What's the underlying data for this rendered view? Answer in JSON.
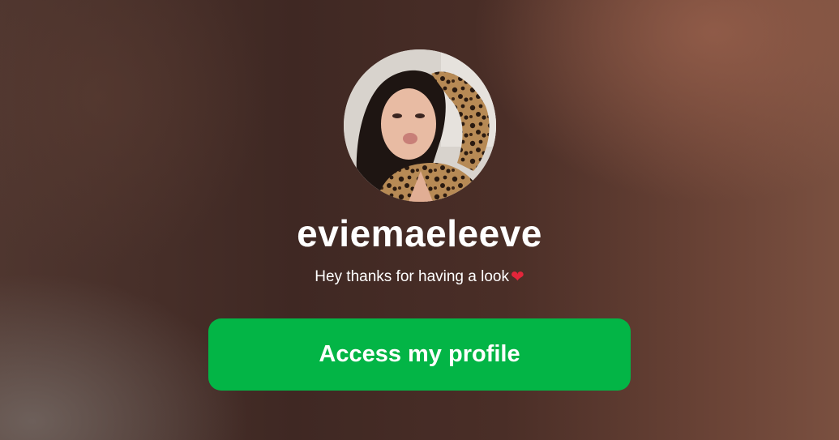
{
  "profile": {
    "username": "eviemaeleeve",
    "bio": "Hey thanks for having a look",
    "bio_emoji": "❤"
  },
  "cta": {
    "label": "Access my profile",
    "color": "#03b546"
  },
  "avatar": {
    "icon": "profile-photo"
  }
}
